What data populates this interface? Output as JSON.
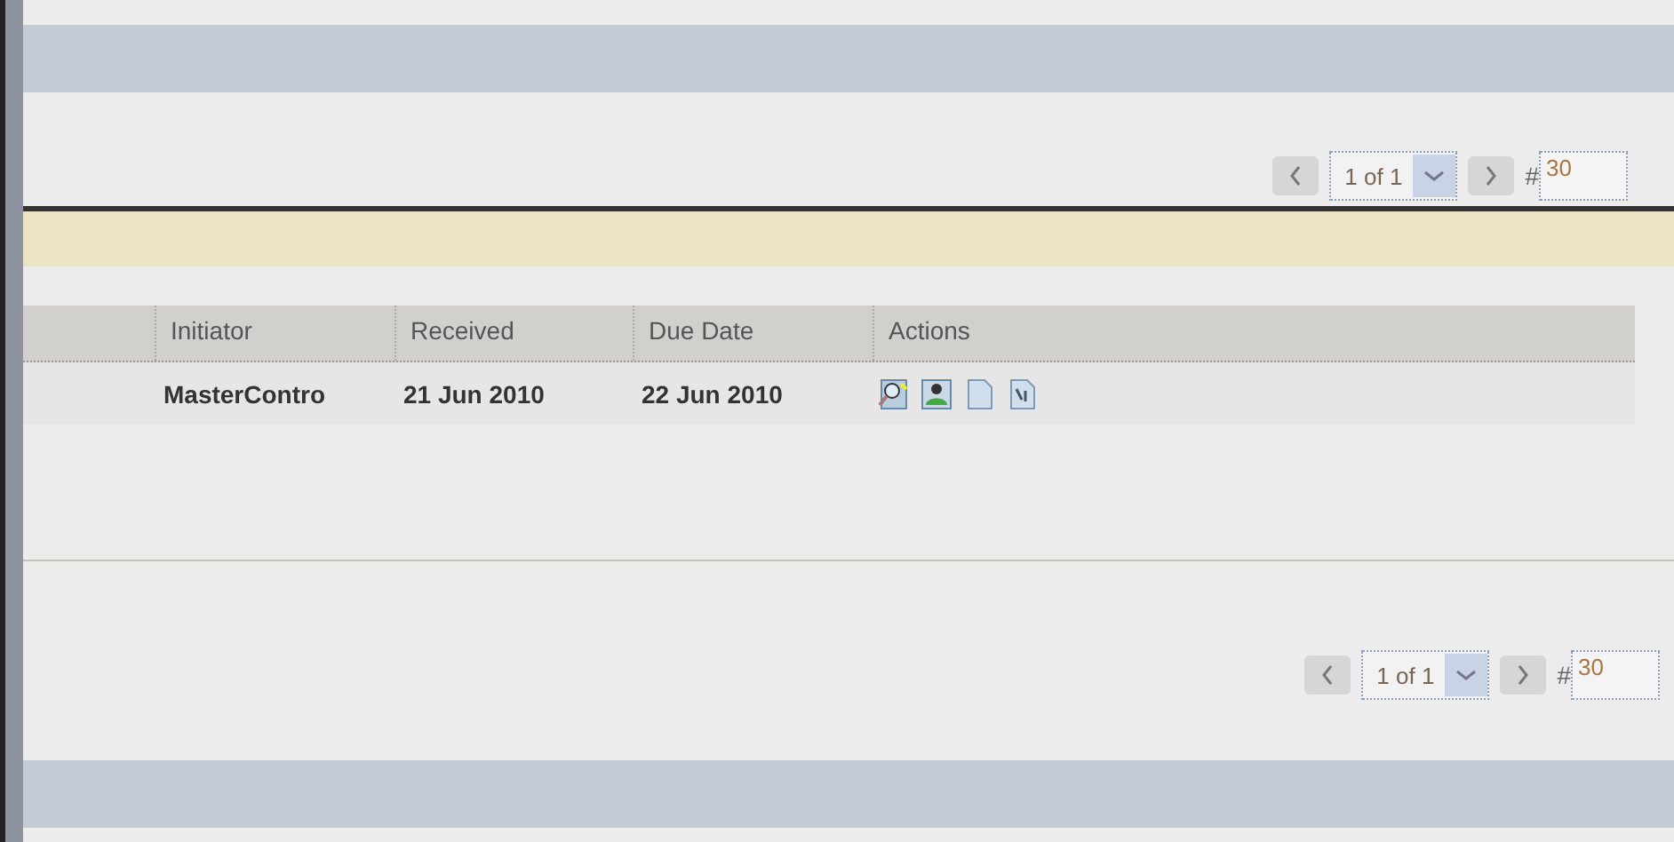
{
  "top_pager": {
    "page": "1 of 1",
    "hash": "#",
    "page_size": "30"
  },
  "table": {
    "columns": [
      "Initiator",
      "Received",
      "Due Date",
      "Actions"
    ],
    "rows": [
      {
        "initiator": "MasterContro",
        "received": "21 Jun 2010",
        "due_date": "22 Jun 2010"
      }
    ]
  },
  "bottom_pager": {
    "page": "1 of 1",
    "hash": "#",
    "page_size": "30"
  }
}
